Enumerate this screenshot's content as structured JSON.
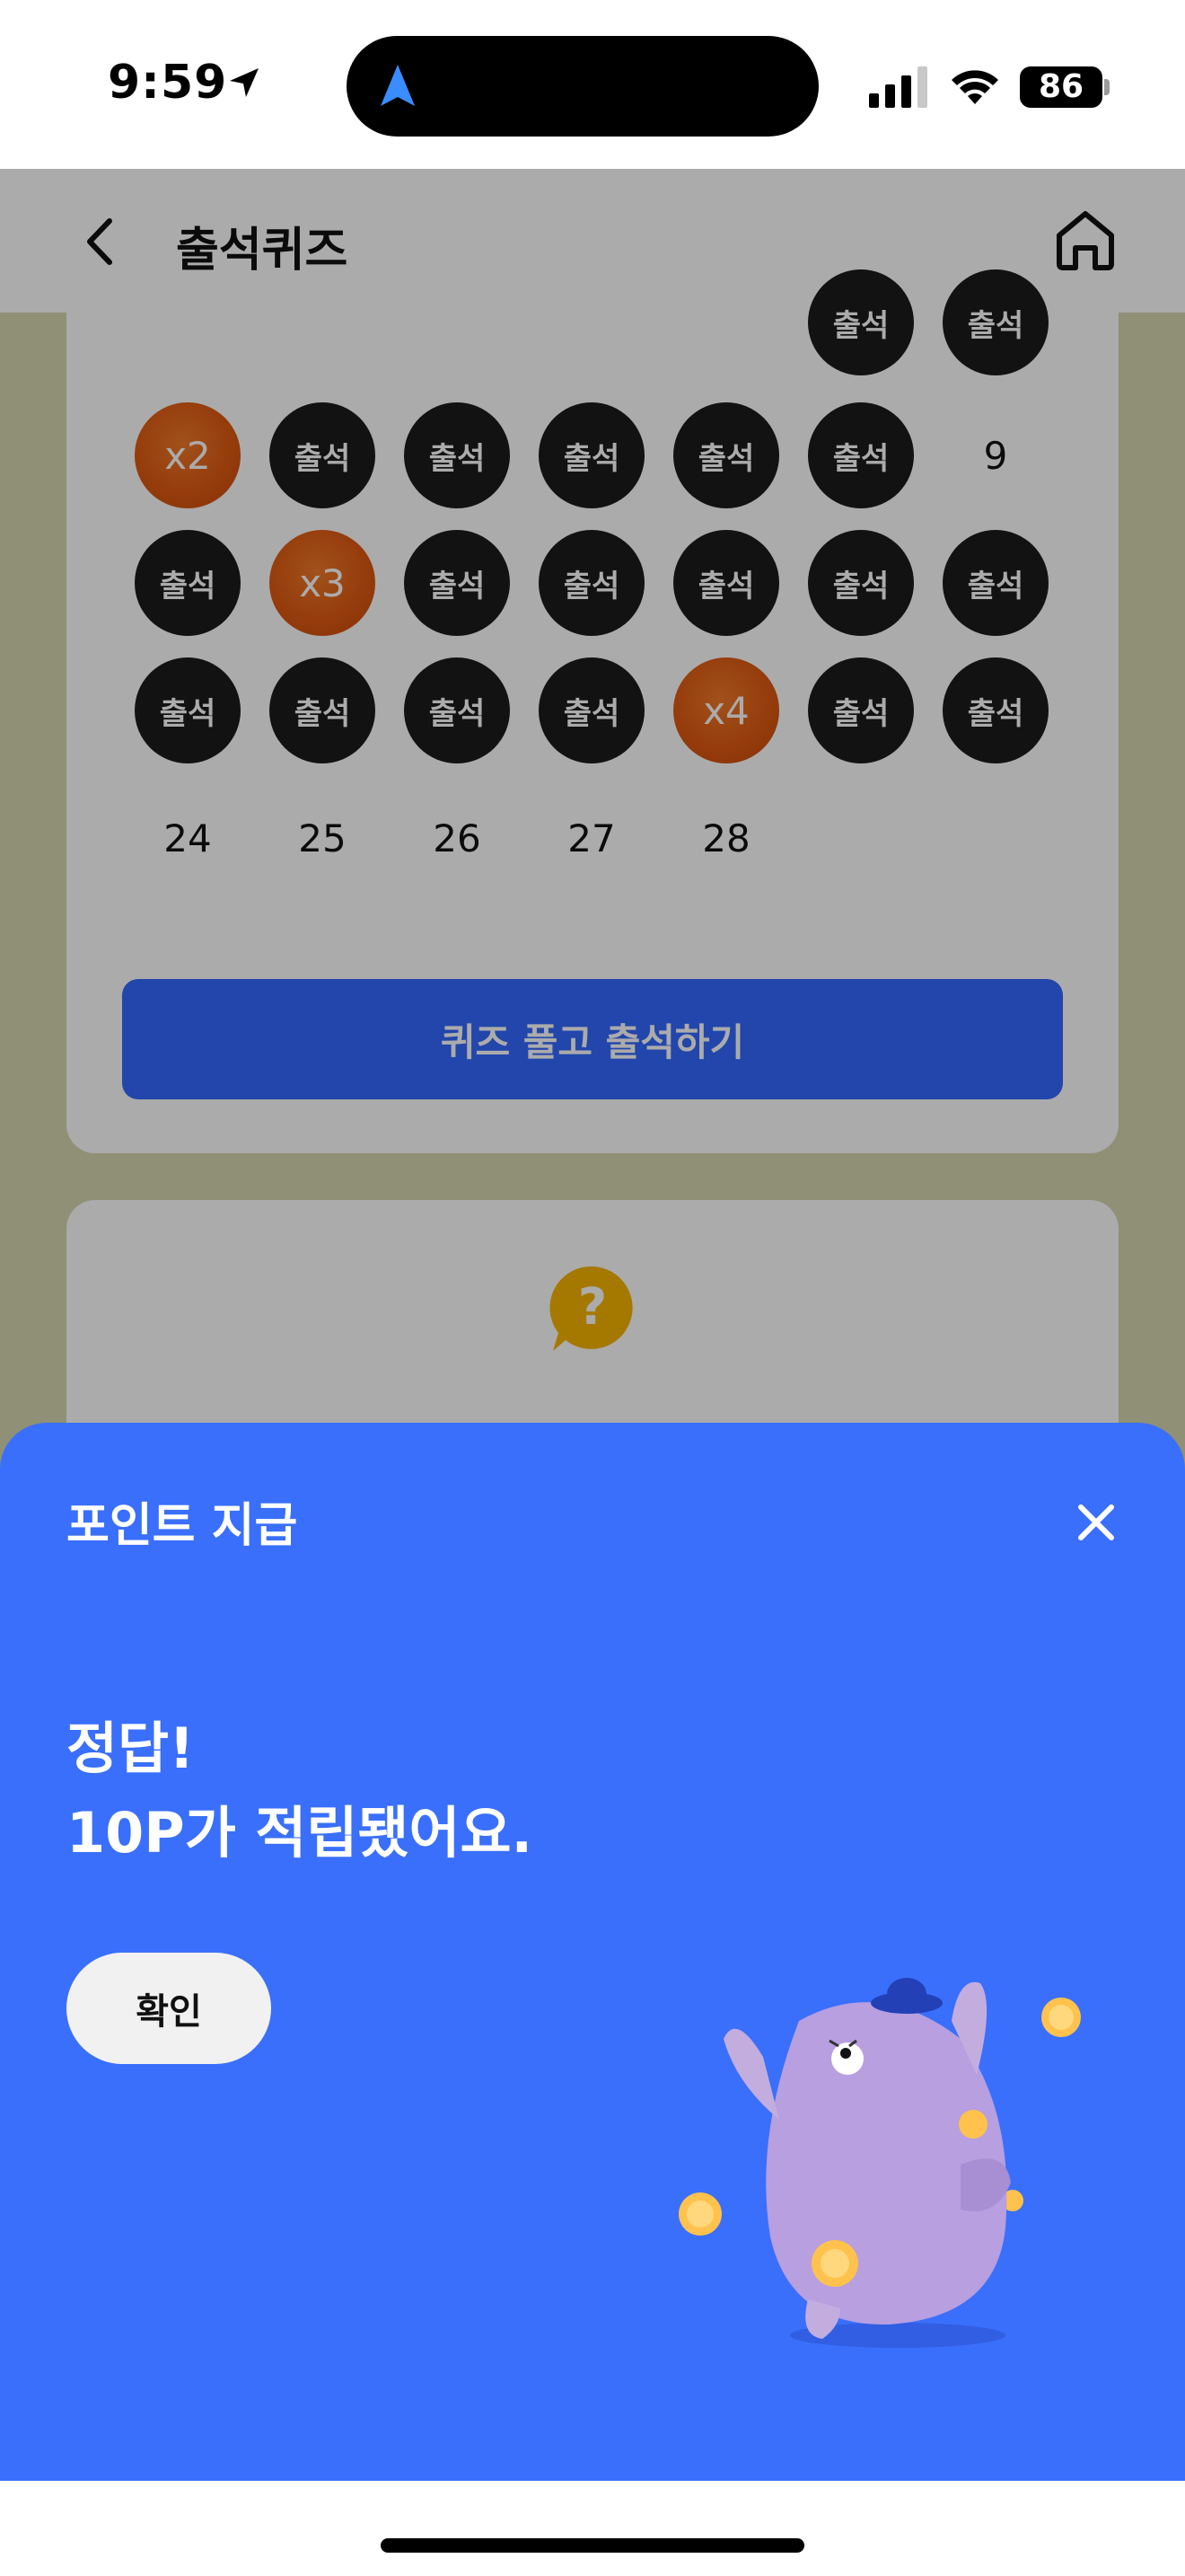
{
  "status_bar": {
    "time": "9:59",
    "battery": "86",
    "icons": [
      "location-arrow-icon",
      "navigation-icon",
      "signal-icon",
      "wifi-icon",
      "battery-icon"
    ]
  },
  "header": {
    "title": "출석퀴즈",
    "back_icon": "chevron-left-icon",
    "home_icon": "home-icon"
  },
  "calendar": {
    "rows": [
      [
        {
          "type": "empty",
          "label": ""
        },
        {
          "type": "empty",
          "label": ""
        },
        {
          "type": "empty",
          "label": ""
        },
        {
          "type": "empty",
          "label": ""
        },
        {
          "type": "empty",
          "label": ""
        },
        {
          "type": "done",
          "label": "출석"
        },
        {
          "type": "done",
          "label": "출석"
        }
      ],
      [
        {
          "type": "bonus",
          "label": "x2"
        },
        {
          "type": "done",
          "label": "출석"
        },
        {
          "type": "done",
          "label": "출석"
        },
        {
          "type": "done",
          "label": "출석"
        },
        {
          "type": "done",
          "label": "출석"
        },
        {
          "type": "done",
          "label": "출석"
        },
        {
          "type": "plain",
          "label": "9"
        }
      ],
      [
        {
          "type": "done",
          "label": "출석"
        },
        {
          "type": "bonus",
          "label": "x3"
        },
        {
          "type": "done",
          "label": "출석"
        },
        {
          "type": "done",
          "label": "출석"
        },
        {
          "type": "done",
          "label": "출석"
        },
        {
          "type": "done",
          "label": "출석"
        },
        {
          "type": "done",
          "label": "출석"
        }
      ],
      [
        {
          "type": "done",
          "label": "출석"
        },
        {
          "type": "done",
          "label": "출석"
        },
        {
          "type": "done",
          "label": "출석"
        },
        {
          "type": "done",
          "label": "출석"
        },
        {
          "type": "bonus",
          "label": "x4"
        },
        {
          "type": "done",
          "label": "출석"
        },
        {
          "type": "done",
          "label": "출석"
        }
      ],
      [
        {
          "type": "plain",
          "label": "24"
        },
        {
          "type": "plain",
          "label": "25"
        },
        {
          "type": "plain",
          "label": "26"
        },
        {
          "type": "plain",
          "label": "27"
        },
        {
          "type": "plain",
          "label": "28"
        },
        {
          "type": "empty",
          "label": ""
        },
        {
          "type": "empty",
          "label": ""
        }
      ]
    ],
    "button_label": "퀴즈 풀고 출석하기"
  },
  "info_card": {
    "icon": "question-bubble-icon"
  },
  "sheet": {
    "title": "포인트 지급",
    "close_icon": "close-icon",
    "message_line1": "정답!",
    "message_line2": "10P가 적립됐어요.",
    "confirm_label": "확인"
  },
  "colors": {
    "accent_blue": "#3a6ffb",
    "bonus_orange": "#e05a12",
    "attended_black": "#1b1b1b",
    "app_background": "#d6d7b0"
  }
}
